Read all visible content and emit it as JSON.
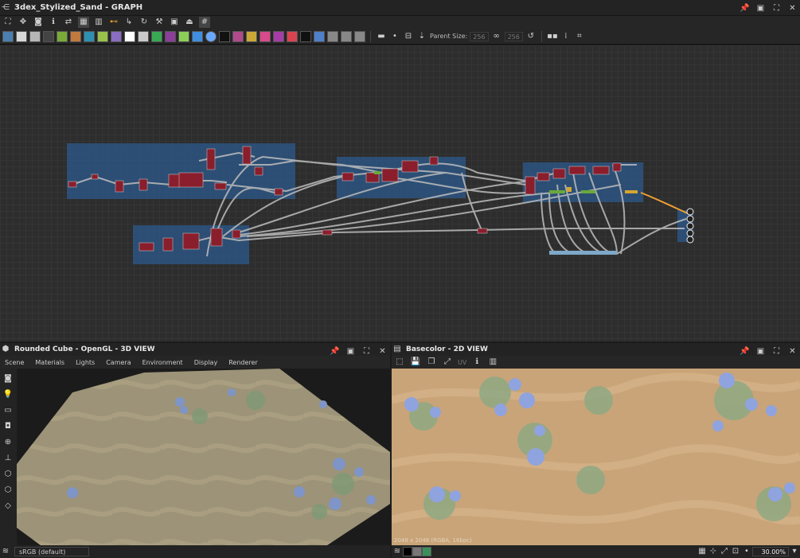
{
  "window": {
    "title": "3dex_Stylized_Sand - GRAPH"
  },
  "graph_toolbar": {
    "parent_size_label": "Parent Size:",
    "parent_size_w": "256",
    "parent_size_h": "256",
    "atomic_icons": [
      "image-input-icon",
      "uniform-color-icon",
      "levels-icon",
      "blend-icon",
      "transform-icon",
      "gradient-map-icon",
      "curve-icon",
      "hsl-icon",
      "blur-icon",
      "warp-icon",
      "normal-icon",
      "emboss-icon",
      "distance-icon",
      "bitmap-icon",
      "svg-icon",
      "fxmap-icon",
      "pixel-processor-icon",
      "gradient-icon",
      "text-icon",
      "tiles-icon",
      "directional-warp-icon",
      "01-value-icon"
    ],
    "colors": [
      "#4b7fb0",
      "#d8d8d8",
      "#b6b6b6",
      "#444444",
      "#7aab39",
      "#c07a3e",
      "#2f8fb0",
      "#9ac24a",
      "#8a6cc0",
      "#ffffff",
      "#c8c8c8",
      "#38a855",
      "#8b3e9a",
      "#8ccf58",
      "#3f8ee0",
      "#6aa8ff",
      "#cc4444",
      "#b04a8a",
      "#c9a836",
      "#d84a8a",
      "#a63da6",
      "#c8c8c8",
      "#4e7fc9",
      "#d94350"
    ]
  },
  "view3d": {
    "title": "Rounded Cube - OpenGL - 3D VIEW",
    "menu": [
      "Scene",
      "Materials",
      "Lights",
      "Camera",
      "Environment",
      "Display",
      "Renderer"
    ],
    "colorspace": "sRGB (default)"
  },
  "view2d": {
    "title": "Basecolor - 2D VIEW",
    "uv_label": "UV",
    "resolution": "2048 x 2048 (RGBA, 16bpc)",
    "zoom": "30.00%"
  }
}
